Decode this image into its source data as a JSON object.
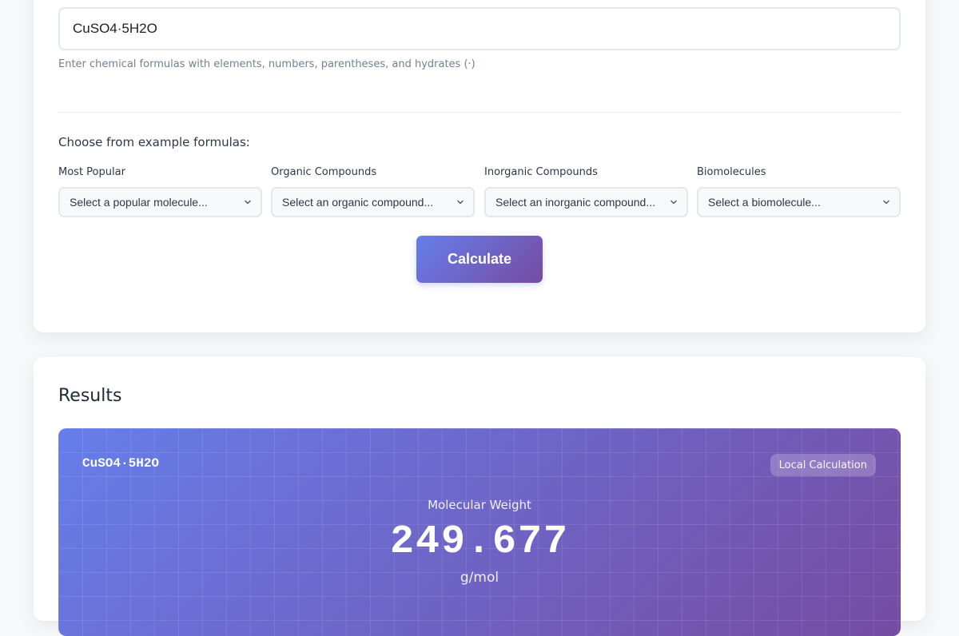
{
  "formula_input": {
    "value": "CuSO4·5H2O",
    "hint": "Enter chemical formulas with elements, numbers, parentheses, and hydrates (·)"
  },
  "examples": {
    "title": "Choose from example formulas:",
    "groups": [
      {
        "label": "Most Popular",
        "placeholder": "Select a popular molecule..."
      },
      {
        "label": "Organic Compounds",
        "placeholder": "Select an organic compound..."
      },
      {
        "label": "Inorganic Compounds",
        "placeholder": "Select an inorganic compound..."
      },
      {
        "label": "Biomolecules",
        "placeholder": "Select a biomolecule..."
      }
    ]
  },
  "calculate_button": {
    "label": "Calculate"
  },
  "results": {
    "title": "Results",
    "formula": "CuSO4·5H2O",
    "badge": "Local Calculation",
    "weight_label": "Molecular Weight",
    "weight_value": "249.677",
    "weight_unit": "g/mol"
  },
  "icons": {
    "select_chevron": "chevron-down-icon"
  },
  "colors": {
    "accent_start": "#667eea",
    "accent_end": "#764ba2",
    "background": "#f7f8fa",
    "card": "#ffffff"
  }
}
